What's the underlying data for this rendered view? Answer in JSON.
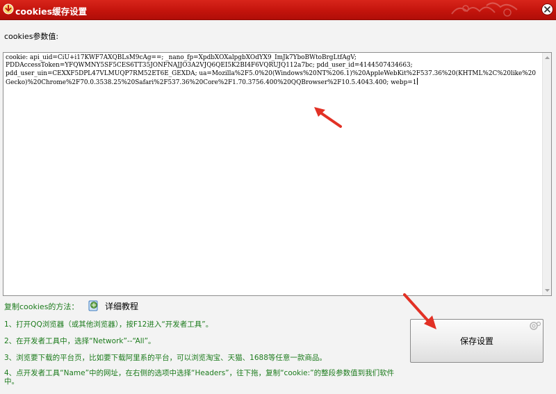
{
  "window": {
    "title": "cookies缓存设置",
    "accent": "#c4140c"
  },
  "param_label": "cookies参数值:",
  "cookie_text": "cookie: api_uid=CiU+i17KWF7AXQBLsM9cAg==; _nano_fp=XpdbXOXalpgbXOdYX9_ImJk7YboBWtoBrgLtfAgV;\nPDDAccessToken=YFQWMNY5SF5CES6TT35JONFNAJJO3A2VJQ6QEI5K2BI4F6VQRUJQ112a7bc; pdd_user_id=4144507434663;\npdd_user_uin=CEXXF5DPL47VLMUQP7RM52ET6E_GEXDA; ua=Mozilla%2F5.0%20(Windows%20NT%206.1)%20AppleWebKit%2F537.36%20(KHTML%2C%20like%20Gecko)%20Chrome%2F70.0.3538.25%20Safari%2F537.36%20Core%2F1.70.3756.400%20QQBrowser%2F10.5.4043.400; webp=1",
  "instructions": {
    "heading": "复制cookies的方法：",
    "tutorial_link": "详细教程",
    "steps": [
      "1、打开QQ浏览器（或其他浏览器），按F12进入“开发者工具”。",
      "2、在开发者工具中，选择“Network”--“All”。",
      "3、浏览要下载的平台页，比如要下载阿里系的平台，可以浏览淘宝、天猫、1688等任意一款商品。",
      "4、点开发者工具“Name”中的网址，在右侧的选项中选择“Headers”，往下拖，复制“cookie:”的整段参数值到我们软件中。"
    ]
  },
  "save_button": "保存设置",
  "icons": {
    "title": "download-arrow-icon",
    "close": "close-icon",
    "tutorial": "tutorial-book-icon",
    "annotation": "red-arrow-annotation"
  }
}
